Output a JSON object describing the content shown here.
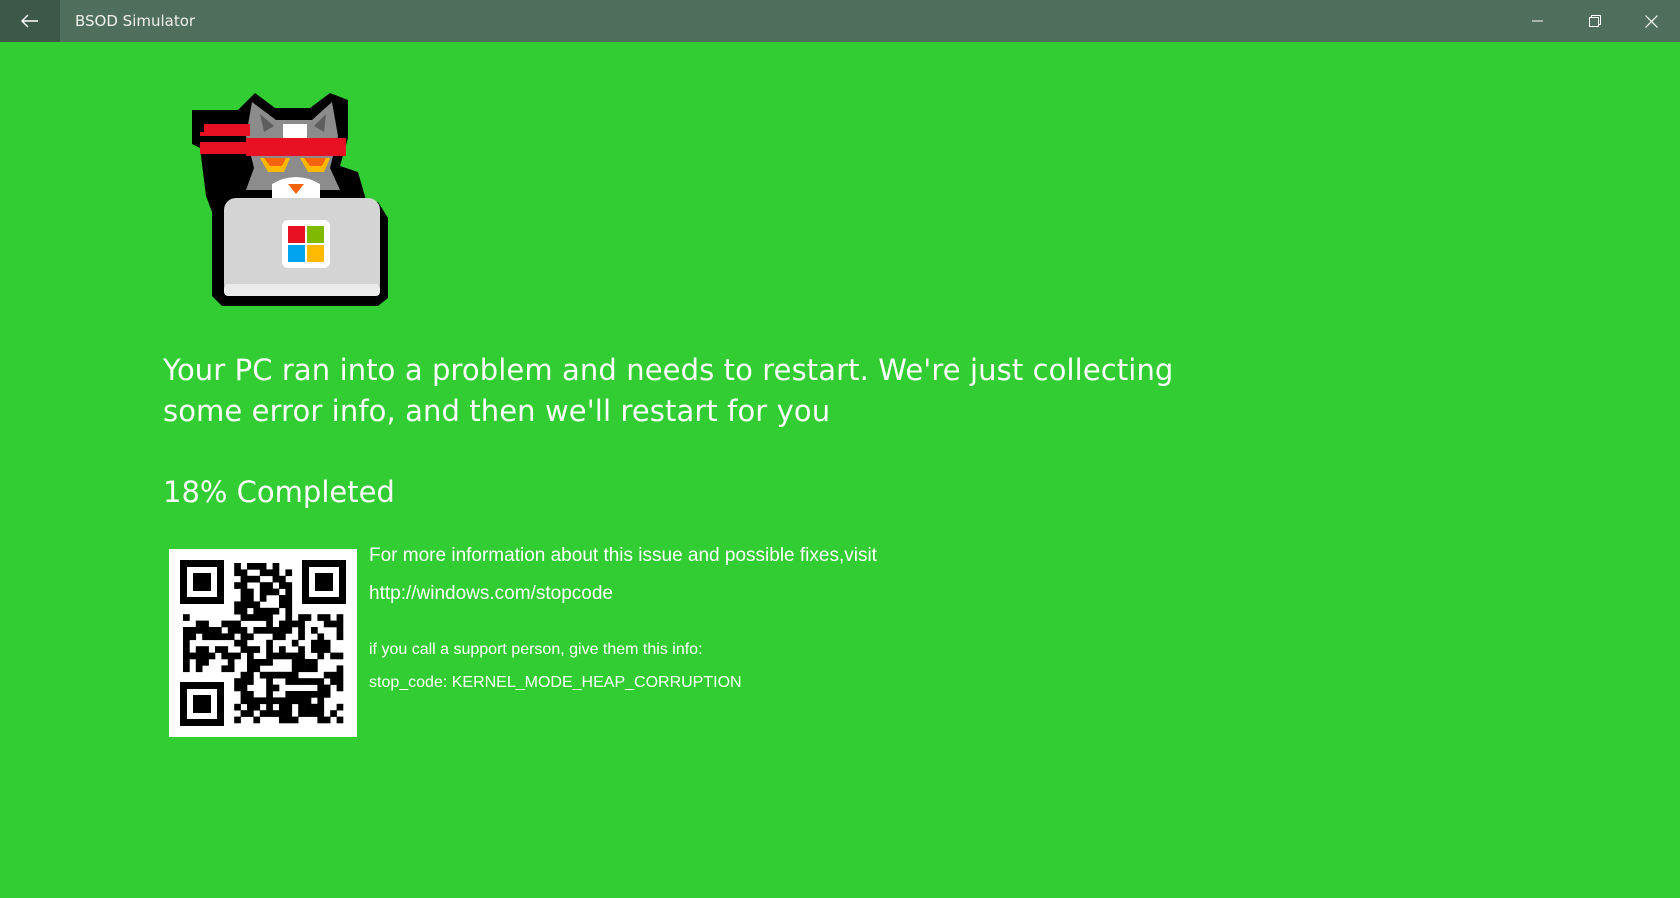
{
  "window": {
    "title": "BSOD Simulator",
    "back_icon": "arrow-left-icon",
    "minimize_icon": "minimize-icon",
    "restore_icon": "restore-icon",
    "close_icon": "close-icon"
  },
  "colors": {
    "background": "#32cd32",
    "titlebar": "#4f6e5b",
    "text": "#ffffff"
  },
  "mascot": {
    "icon": "ninja-cat-laptop-icon"
  },
  "error": {
    "headline": "Your PC ran into a problem and needs to restart. We're just collecting some error info, and then we'll restart for you",
    "progress_text": "18% Completed",
    "progress_percent": 18
  },
  "info": {
    "more_info": "For more information about this issue and possible fixes,visit",
    "url": "http://windows.com/stopcode",
    "support": "if you call a support person, give them this info:",
    "stop_code": "stop_code: KERNEL_MODE_HEAP_CORRUPTION"
  },
  "qr": {
    "icon": "qr-code-icon"
  }
}
